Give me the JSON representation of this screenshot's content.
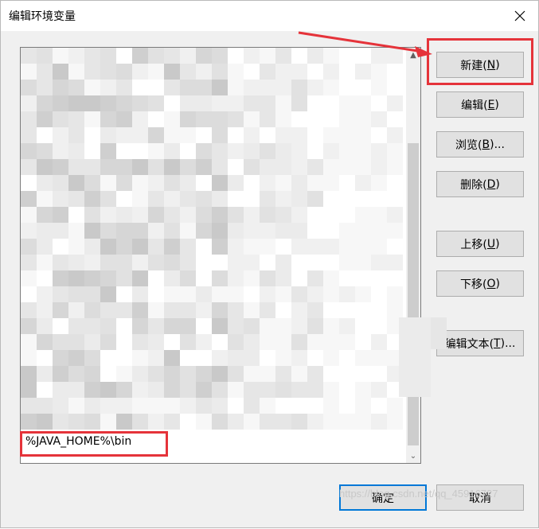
{
  "window": {
    "title": "编辑环境变量",
    "close_icon": "close-icon"
  },
  "list": {
    "visible_entry": "%JAVA_HOME%\\bin",
    "scroll_up_glyph": "▲",
    "scroll_down_glyph": "⌄"
  },
  "buttons": {
    "new": {
      "text": "新建(",
      "key": "N",
      "end": ")"
    },
    "edit": {
      "text": "编辑(",
      "key": "E",
      "end": ")"
    },
    "browse": {
      "text": "浏览(",
      "key": "B",
      "end": ")..."
    },
    "delete": {
      "text": "删除(",
      "key": "D",
      "end": ")"
    },
    "move_up": {
      "text": "上移(",
      "key": "U",
      "end": ")"
    },
    "move_down": {
      "text": "下移(",
      "key": "O",
      "end": ")"
    },
    "edit_text": {
      "text": "编辑文本(",
      "key": "T",
      "end": ")..."
    },
    "ok": "确定",
    "cancel": "取消"
  },
  "watermark": "https://blog.csdn.net/qq_45916727",
  "colors": {
    "highlight_red": "#e5333a",
    "focus_blue": "#0078d7",
    "button_face": "#e1e1e1"
  }
}
